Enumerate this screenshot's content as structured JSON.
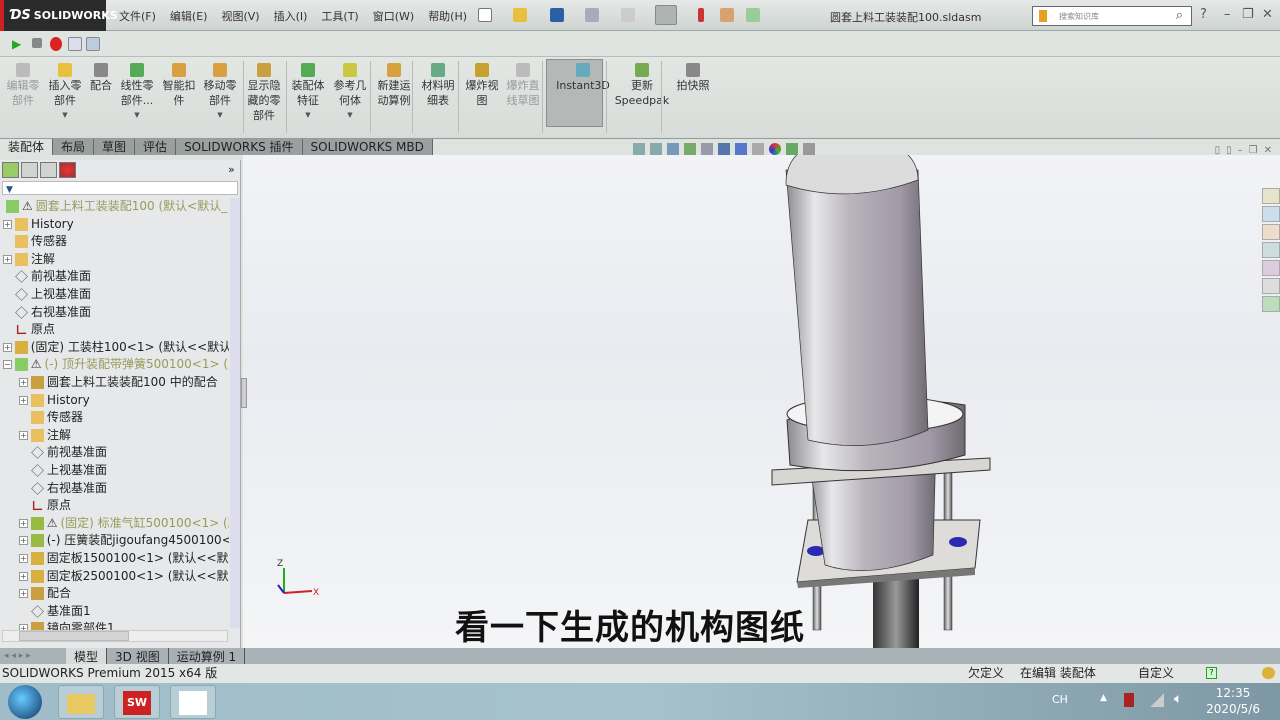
{
  "app": {
    "logo": "SOLIDWORKS",
    "title": "圆套上料工装装配100.sldasm",
    "search_placeholder": "搜索知识库"
  },
  "menu": [
    "文件(F)",
    "编辑(E)",
    "视图(V)",
    "插入(I)",
    "工具(T)",
    "窗口(W)",
    "帮助(H)"
  ],
  "ribbon": [
    {
      "label": "编辑零部件",
      "disabled": true,
      "icon": "edit-component-icon"
    },
    {
      "label": "插入零部件",
      "dropdown": true,
      "icon": "insert-component-icon"
    },
    {
      "label": "配合",
      "icon": "mate-icon"
    },
    {
      "label": "线性零部件...",
      "dropdown": true,
      "icon": "linear-pattern-icon"
    },
    {
      "label": "智能扣件",
      "icon": "smart-fastener-icon"
    },
    {
      "label": "移动零部件",
      "dropdown": true,
      "icon": "move-component-icon"
    },
    {
      "label": "显示隐藏的零部件",
      "icon": "show-hidden-icon"
    },
    {
      "label": "装配体特征",
      "dropdown": true,
      "icon": "assembly-feature-icon"
    },
    {
      "label": "参考几何体",
      "dropdown": true,
      "icon": "reference-geometry-icon"
    },
    {
      "label": "新建运动算例",
      "icon": "motion-study-icon"
    },
    {
      "label": "材料明细表",
      "icon": "bom-icon"
    },
    {
      "label": "爆炸视图",
      "icon": "exploded-view-icon"
    },
    {
      "label": "爆炸直线草图",
      "disabled": true,
      "icon": "explode-line-sketch-icon"
    },
    {
      "label": "Instant3D",
      "active": true,
      "icon": "instant3d-icon"
    },
    {
      "label": "更新 Speedpak",
      "icon": "speedpak-icon"
    },
    {
      "label": "拍快照",
      "icon": "snapshot-icon"
    }
  ],
  "tabs": [
    "装配体",
    "布局",
    "草图",
    "评估",
    "SOLIDWORKS 插件",
    "SOLIDWORKS MBD"
  ],
  "tree": [
    {
      "level": 0,
      "text": "圆套上料工装装配100 (默认<默认_!",
      "icon": "assembly",
      "warn": true,
      "pm": ""
    },
    {
      "level": 0,
      "text": "History",
      "icon": "history",
      "pm": "+"
    },
    {
      "level": 0,
      "text": "传感器",
      "icon": "sensor",
      "pm": ""
    },
    {
      "level": 0,
      "text": "注解",
      "icon": "annotation",
      "pm": "+"
    },
    {
      "level": 0,
      "text": "前视基准面",
      "icon": "plane",
      "pm": ""
    },
    {
      "level": 0,
      "text": "上视基准面",
      "icon": "plane",
      "pm": ""
    },
    {
      "level": 0,
      "text": "右视基准面",
      "icon": "plane",
      "pm": ""
    },
    {
      "level": 0,
      "text": "原点",
      "icon": "origin",
      "pm": ""
    },
    {
      "level": 0,
      "text": "(固定) 工装柱100<1> (默认<<默认",
      "icon": "part",
      "pm": "+"
    },
    {
      "level": 0,
      "text": "(-) 顶升装配带弹簧500100<1> (默",
      "icon": "assembly",
      "warn": true,
      "pm": "-"
    },
    {
      "level": 1,
      "text": "圆套上料工装装配100 中的配合",
      "icon": "mates",
      "pm": "+"
    },
    {
      "level": 1,
      "text": "History",
      "icon": "history",
      "pm": "+"
    },
    {
      "level": 1,
      "text": "传感器",
      "icon": "sensor",
      "pm": ""
    },
    {
      "level": 1,
      "text": "注解",
      "icon": "annotation",
      "pm": "+"
    },
    {
      "level": 1,
      "text": "前视基准面",
      "icon": "plane",
      "pm": ""
    },
    {
      "level": 1,
      "text": "上视基准面",
      "icon": "plane",
      "pm": ""
    },
    {
      "level": 1,
      "text": "右视基准面",
      "icon": "plane",
      "pm": ""
    },
    {
      "level": 1,
      "text": "原点",
      "icon": "origin",
      "pm": ""
    },
    {
      "level": 1,
      "text": "(固定) 标准气缸500100<1> (默",
      "icon": "subassembly",
      "warn": true,
      "pm": "+"
    },
    {
      "level": 1,
      "text": "(-) 压簧装配jigoufang4500100<",
      "icon": "subassembly",
      "pm": "+"
    },
    {
      "level": 1,
      "text": "固定板1500100<1> (默认<<默认",
      "icon": "part",
      "pm": "+"
    },
    {
      "level": 1,
      "text": "固定板2500100<1> (默认<<默认",
      "icon": "part",
      "pm": "+"
    },
    {
      "level": 1,
      "text": "配合",
      "icon": "mates",
      "pm": "+"
    },
    {
      "level": 1,
      "text": "基准面1",
      "icon": "plane",
      "pm": ""
    },
    {
      "level": 1,
      "text": "镜向零部件1",
      "icon": "mirror",
      "pm": "+"
    }
  ],
  "bottom_tabs": [
    "模型",
    "3D 视图",
    "运动算例 1"
  ],
  "status": {
    "product": "SOLIDWORKS Premium 2015 x64 版",
    "definition": "欠定义",
    "mode": "在编辑 装配体",
    "units": "自定义"
  },
  "subtitle": "看一下生成的机构图纸",
  "triad": {
    "z": "Z",
    "x": "X"
  },
  "taskbar": {
    "lang": "CH",
    "time": "12:35",
    "date": "2020/5/6"
  },
  "colors": {
    "accent": "#c22222",
    "warn_text": "#9a9a5a",
    "instant3d_active": "#b4b9b7"
  }
}
